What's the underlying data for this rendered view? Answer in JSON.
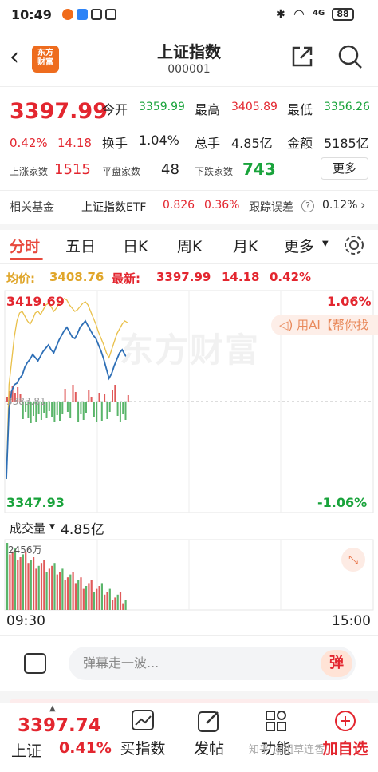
{
  "status": {
    "time": "10:49",
    "battery": "88",
    "network": "4G"
  },
  "header": {
    "title": "上证指数",
    "code": "000001",
    "logo_line1": "东方",
    "logo_line2": "财富"
  },
  "quote": {
    "price": "3397.99",
    "pct": "0.42%",
    "chg": "14.18",
    "open_label": "今开",
    "open": "3359.99",
    "high_label": "最高",
    "high": "3405.89",
    "low_label": "最低",
    "low": "3356.26",
    "turnover_label": "换手",
    "turnover": "1.04%",
    "volume_label": "总手",
    "volume": "4.85亿",
    "amount_label": "金额",
    "amount": "5185亿",
    "up_label": "上涨家数",
    "up": "1515",
    "flat_label": "平盘家数",
    "flat": "48",
    "down_label": "下跌家数",
    "down": "743",
    "more": "更多"
  },
  "fund": {
    "label": "相关基金",
    "name": "上证指数ETF",
    "price": "0.826",
    "pct": "0.36%",
    "err_label": "跟踪误差",
    "err": "0.12%"
  },
  "tabs": [
    "分时",
    "五日",
    "日K",
    "周K",
    "月K",
    "更多"
  ],
  "chart": {
    "avg_label": "均价:",
    "avg": "3408.76",
    "last_label": "最新:",
    "last": "3397.99",
    "last_chg": "14.18",
    "last_pct": "0.42%",
    "top_price": "3419.69",
    "top_pct": "1.06%",
    "bottom_price": "3347.93",
    "bottom_pct": "-1.06%",
    "mid_label": "3383.81",
    "watermark": "东方财富",
    "ai_tip": "用AI【帮你找",
    "vol_label": "成交量",
    "vol_value": "4.85亿",
    "vol_max": "2456万",
    "time_start": "09:30",
    "time_end": "15:00"
  },
  "danmu": {
    "placeholder": "弹幕走一波...",
    "btn": "弹"
  },
  "bottom": {
    "price": "3397.74",
    "name": "上证",
    "pct": "0.41%",
    "items": [
      "买指数",
      "发帖",
      "功能",
      "加自选"
    ],
    "zhihu": "知乎 @祖草连香"
  }
}
